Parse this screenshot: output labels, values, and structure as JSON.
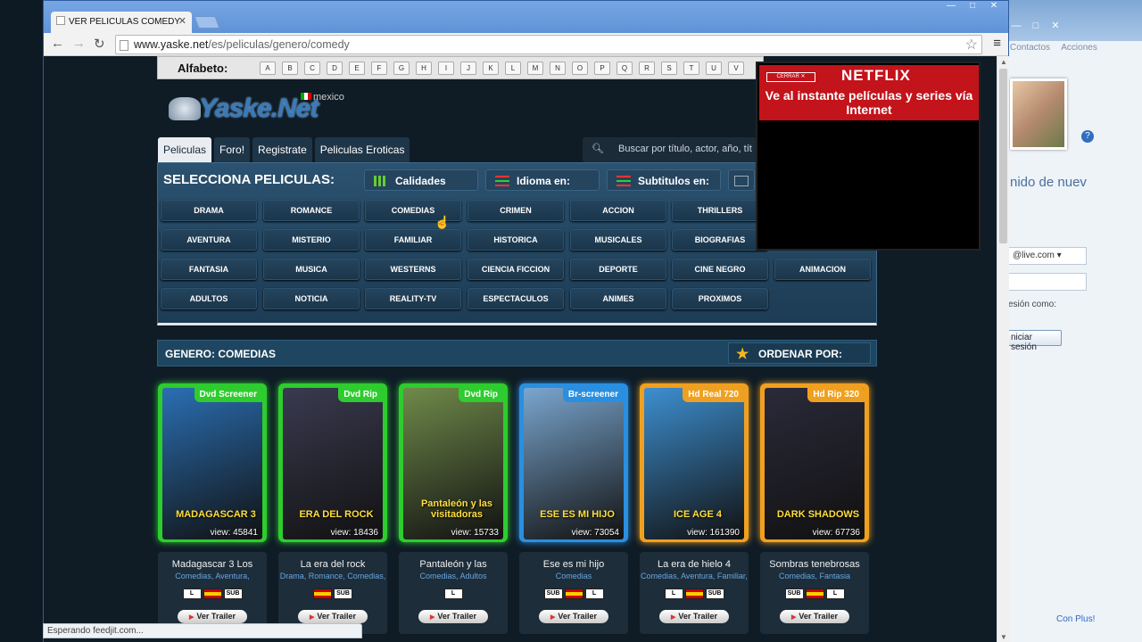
{
  "browser": {
    "tab_title": "VER PELICULAS COMEDY",
    "url_host": "www.yaske.net",
    "url_path": "/es/peliculas/genero/comedy",
    "status_text": "Esperando feedjit.com..."
  },
  "side_window": {
    "nav": [
      "Contactos",
      "Acciones"
    ],
    "welcome": "nido de nuev",
    "email_domain": "@live.com",
    "session_label": "esión como:",
    "login_button": "niciar sesión",
    "footer": "Con Plus!"
  },
  "site": {
    "alfabeto_label": "Alfabeto:",
    "letters": [
      "A",
      "B",
      "C",
      "D",
      "E",
      "F",
      "G",
      "H",
      "I",
      "J",
      "K",
      "L",
      "M",
      "N",
      "O",
      "P",
      "Q",
      "R",
      "S",
      "T",
      "U",
      "V"
    ],
    "logo_text": "Yaske.Net",
    "logo_region": "mexico",
    "nav": [
      "Peliculas",
      "Foro!",
      "Registrate",
      "Peliculas Eroticas"
    ],
    "search_placeholder": "Buscar por título, actor, año, tít",
    "select_heading": "SELECCIONA PELICULAS:",
    "filters": [
      "Calidades",
      "Idioma en:",
      "Subtitulos en:"
    ],
    "genres": [
      "DRAMA",
      "ROMANCE",
      "COMEDIAS",
      "CRIMEN",
      "ACCION",
      "THRILLERS",
      "AVENTURA",
      "MISTERIO",
      "FAMILIAR",
      "HISTORICA",
      "MUSICALES",
      "BIOGRAFIAS",
      "FANTASIA",
      "MUSICA",
      "WESTERNS",
      "CIENCIA FICCION",
      "DEPORTE",
      "CINE NEGRO",
      "ANIMACION",
      "ADULTOS",
      "NOTICIA",
      "REALITY-TV",
      "ESPECTACULOS",
      "ANIMES",
      "PROXIMOS"
    ],
    "genre_bar": "GENERO: COMEDIAS",
    "order_by": "ORDENAR POR:",
    "trailer_label": "Ver Trailer"
  },
  "movies": [
    {
      "name": "Madagascar 3 Los",
      "genres": "Comedias, Aventura,",
      "quality": "Dvd Screener",
      "views": "view: 45841",
      "poster_text": "MADAGASCAR 3",
      "langs": [
        "L",
        "ES",
        "SUB"
      ],
      "color": "#2ecc2e",
      "poster_bg": "#2a6fb3"
    },
    {
      "name": "La era del rock",
      "genres": "Drama, Romance, Comedias,",
      "quality": "Dvd Rip",
      "views": "view: 18436",
      "poster_text": "ERA DEL ROCK",
      "langs": [
        "ES",
        "SUB"
      ],
      "color": "#2ecc2e",
      "poster_bg": "#3a3a50"
    },
    {
      "name": "Pantaleón y las",
      "genres": "Comedias, Adultos",
      "quality": "Dvd Rip",
      "views": "view: 15733",
      "poster_text": "Pantaleón y las visitadoras",
      "langs": [
        "L"
      ],
      "color": "#2ecc2e",
      "poster_bg": "#6f8a4a"
    },
    {
      "name": "Ese es mi hijo",
      "genres": "Comedias",
      "quality": "Br-screener",
      "views": "view: 73054",
      "poster_text": "ESE ES MI HIJO",
      "langs": [
        "SUB",
        "ES",
        "L"
      ],
      "color": "#2a8fe0",
      "poster_bg": "#7aa6cf"
    },
    {
      "name": "La era de hielo 4",
      "genres": "Comedias, Aventura, Familiar,",
      "quality": "Hd Real 720",
      "views": "view: 161390",
      "poster_text": "ICE AGE 4",
      "langs": [
        "L",
        "ES",
        "SUB"
      ],
      "color": "#f0a020",
      "poster_bg": "#3d8fd0"
    },
    {
      "name": "Sombras tenebrosas",
      "genres": "Comedias, Fantasia",
      "quality": "Hd Rip 320",
      "views": "view: 67736",
      "poster_text": "DARK SHADOWS",
      "langs": [
        "SUB",
        "ES",
        "L"
      ],
      "color": "#f0a020",
      "poster_bg": "#2a2a3a"
    }
  ],
  "ad": {
    "close": "CERRAR ✕",
    "brand": "NETFLIX",
    "message": "Ve al instante películas y series vía Internet"
  }
}
